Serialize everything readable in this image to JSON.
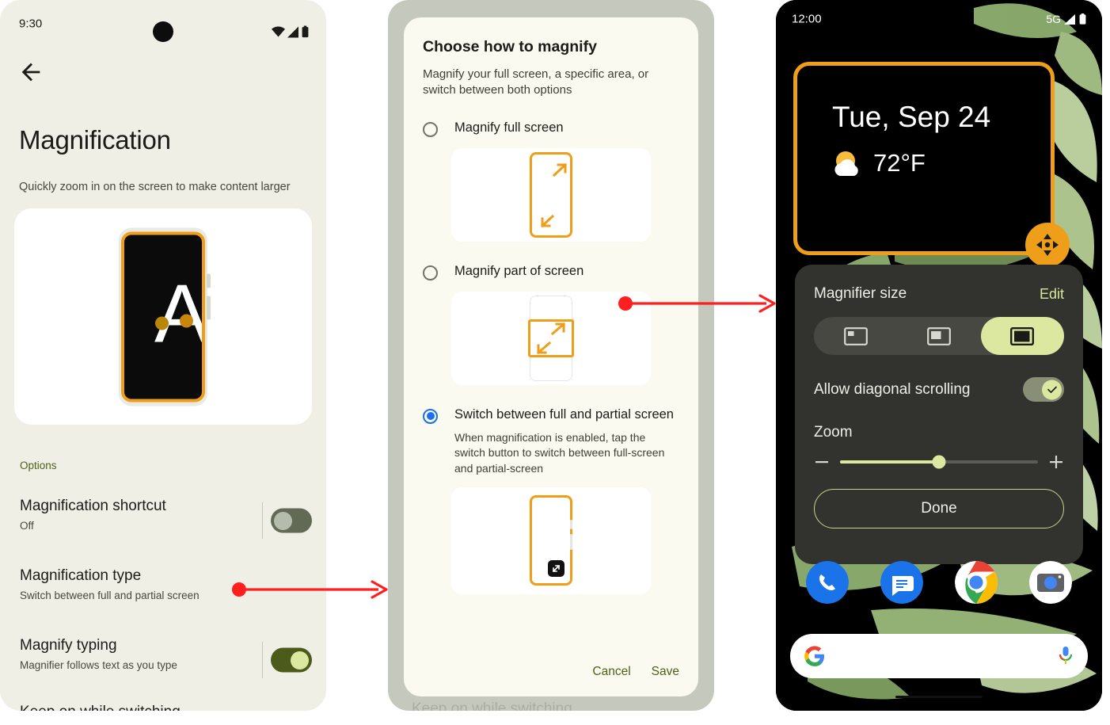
{
  "panel_settings": {
    "status_bar": {
      "time": "9:30",
      "icons": [
        "wifi-icon",
        "signal-icon",
        "battery-icon"
      ]
    },
    "back_icon": "back-arrow-icon",
    "title": "Magnification",
    "subtitle": "Quickly zoom in on the screen to make content larger",
    "hero_letter": "A",
    "section_label": "Options",
    "rows": [
      {
        "title": "Magnification shortcut",
        "subtitle": "Off",
        "toggle": "off"
      },
      {
        "title": "Magnification type",
        "subtitle": "Switch between full and partial screen",
        "toggle": "none"
      },
      {
        "title": "Magnify typing",
        "subtitle": "Magnifier follows text as you type",
        "toggle": "on"
      }
    ],
    "cut_off_row": "Keep on while switching"
  },
  "panel_dialog": {
    "title": "Choose how to magnify",
    "subtitle": "Magnify your full screen, a specific area, or switch between both options",
    "options": [
      {
        "label": "Magnify full screen",
        "selected": false,
        "description": ""
      },
      {
        "label": "Magnify part of screen",
        "selected": false,
        "description": ""
      },
      {
        "label": "Switch between full and partial screen",
        "selected": true,
        "description": "When magnification is enabled, tap the switch button to switch between full-screen and partial-screen"
      }
    ],
    "cancel_label": "Cancel",
    "save_label": "Save"
  },
  "panel_home": {
    "status_bar": {
      "time": "12:00",
      "network": "5G",
      "icons": [
        "signal-icon",
        "battery-icon"
      ]
    },
    "widget": {
      "date": "Tue, Sep 24",
      "temperature": "72°F",
      "weather_icon": "sun-cloud-icon",
      "move_handle_icon": "move-handle-icon"
    },
    "magnifier_panel": {
      "title": "Magnifier size",
      "edit_label": "Edit",
      "size_options": [
        "size-small-icon",
        "size-medium-icon",
        "size-large-icon"
      ],
      "size_selected_index": 2,
      "diagonal_label": "Allow diagonal scrolling",
      "diagonal_enabled": true,
      "zoom_label": "Zoom",
      "zoom_minus_icon": "minus-icon",
      "zoom_plus_icon": "plus-icon",
      "zoom_percent": 50,
      "done_label": "Done"
    },
    "dock_apps": [
      "phone-app-icon",
      "messages-app-icon",
      "chrome-app-icon",
      "camera-app-icon"
    ],
    "search_bar": {
      "left_icon": "google-g-icon",
      "right_icon": "microphone-icon",
      "value": ""
    }
  },
  "annotations": {
    "arrow_color": "#FF1F1F",
    "arrows": [
      {
        "from": "magnification-type-row",
        "to": "choose-how-to-magnify-dialog"
      },
      {
        "from": "magnify-part-of-screen-option",
        "to": "home-screen-magnifier-panel"
      }
    ]
  }
}
